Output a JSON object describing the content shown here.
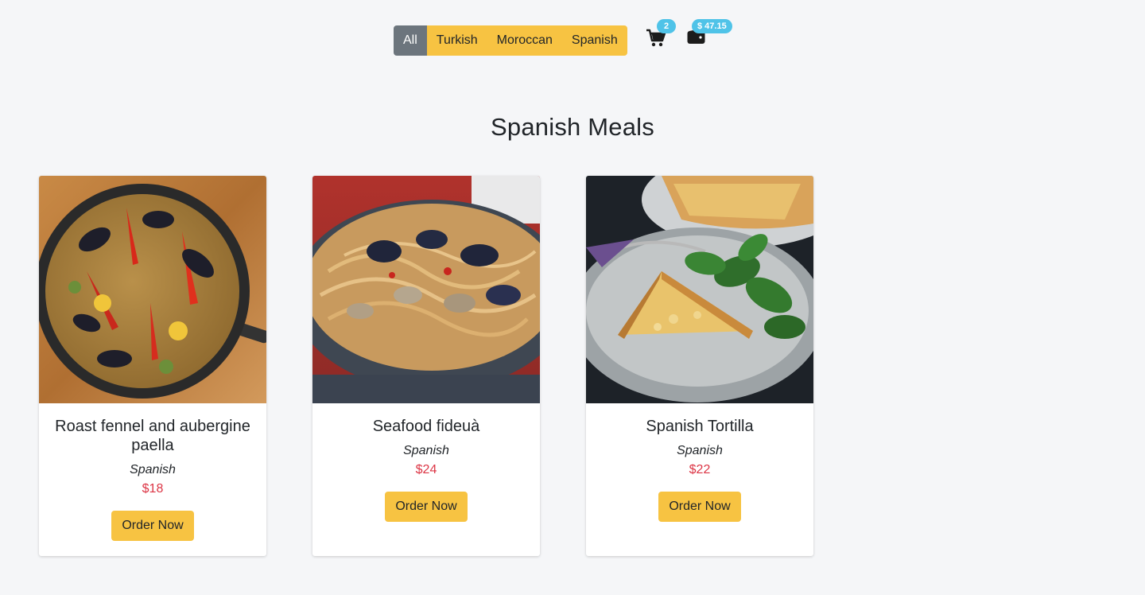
{
  "filters": {
    "items": [
      {
        "label": "All",
        "active": true
      },
      {
        "label": "Turkish",
        "active": false
      },
      {
        "label": "Moroccan",
        "active": false
      },
      {
        "label": "Spanish",
        "active": false
      }
    ]
  },
  "cart": {
    "icon": "cart-icon",
    "count": "2"
  },
  "wallet": {
    "icon": "wallet-icon",
    "balance": "$ 47.15"
  },
  "section": {
    "title": "Spanish Meals"
  },
  "meals": [
    {
      "name": "Roast fennel and aubergine paella",
      "cuisine": "Spanish",
      "price": "$18",
      "button": "Order Now"
    },
    {
      "name": "Seafood fideuà",
      "cuisine": "Spanish",
      "price": "$24",
      "button": "Order Now"
    },
    {
      "name": "Spanish Tortilla",
      "cuisine": "Spanish",
      "price": "$22",
      "button": "Order Now"
    }
  ],
  "colors": {
    "accent": "#f7c342",
    "active_filter": "#6c757d",
    "badge": "#4fc3e8",
    "price": "#dc3545",
    "background": "#f5f6f8"
  }
}
